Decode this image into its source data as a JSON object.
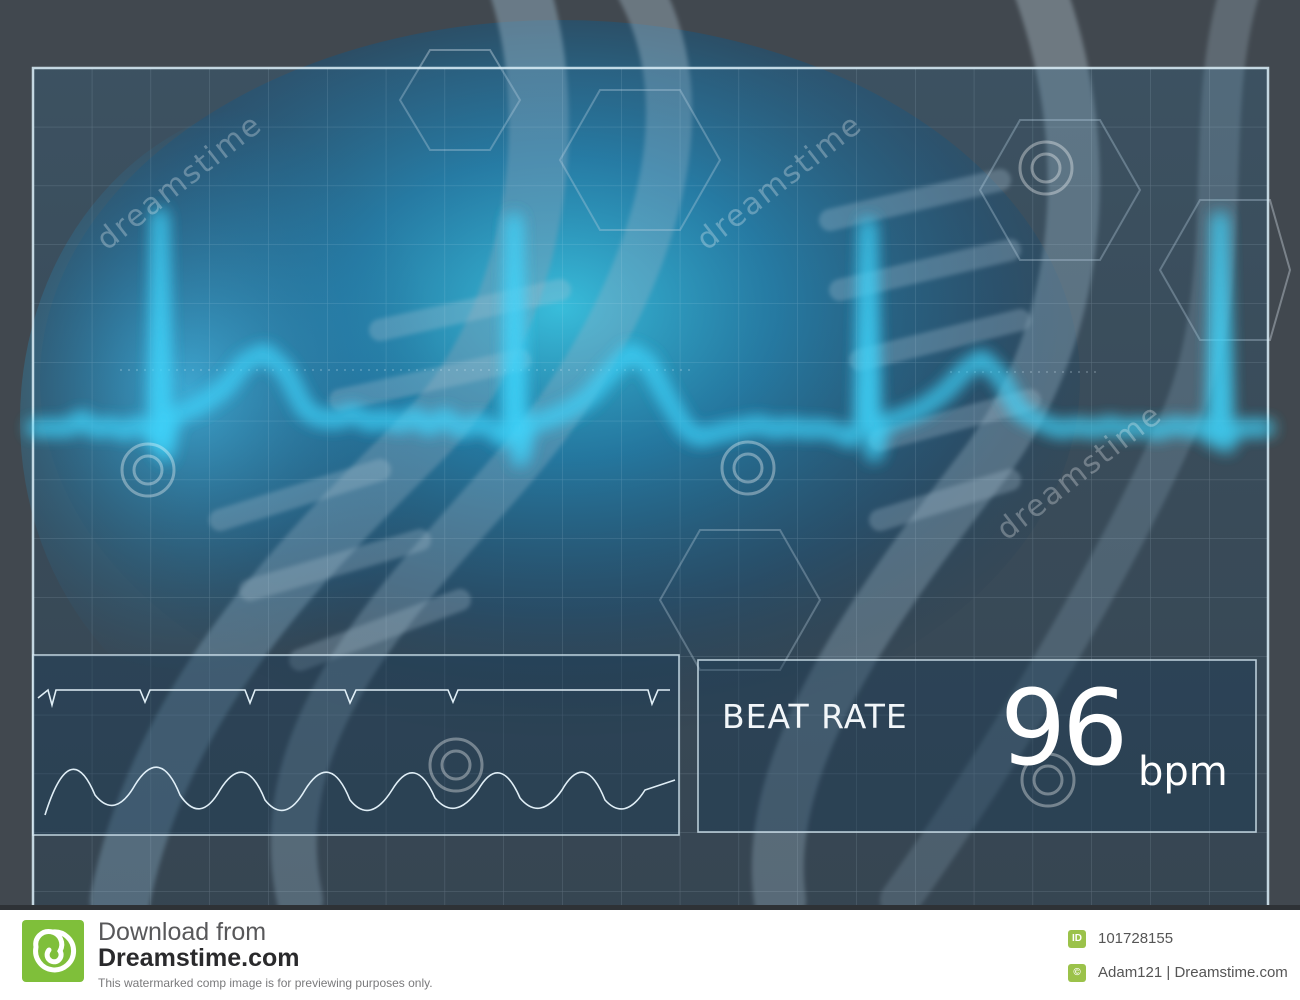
{
  "display": {
    "label": "BEAT RATE",
    "value": "96",
    "unit": "bpm"
  },
  "watermark": {
    "text": "dreamstime"
  },
  "footer": {
    "download_text": "Download from",
    "brand": "Dreamstime.com",
    "note": "This watermarked comp image is for previewing purposes only.",
    "id_badge": "ID",
    "image_id": "101728155",
    "author_badge": "©",
    "author": "Adam121 | Dreamstime.com"
  },
  "colors": {
    "frame_line": "#d7ecf7",
    "ecg_glow": "#bff4ff",
    "accent_blue": "#27b8ec",
    "brand_green": "#7fbf3a"
  }
}
